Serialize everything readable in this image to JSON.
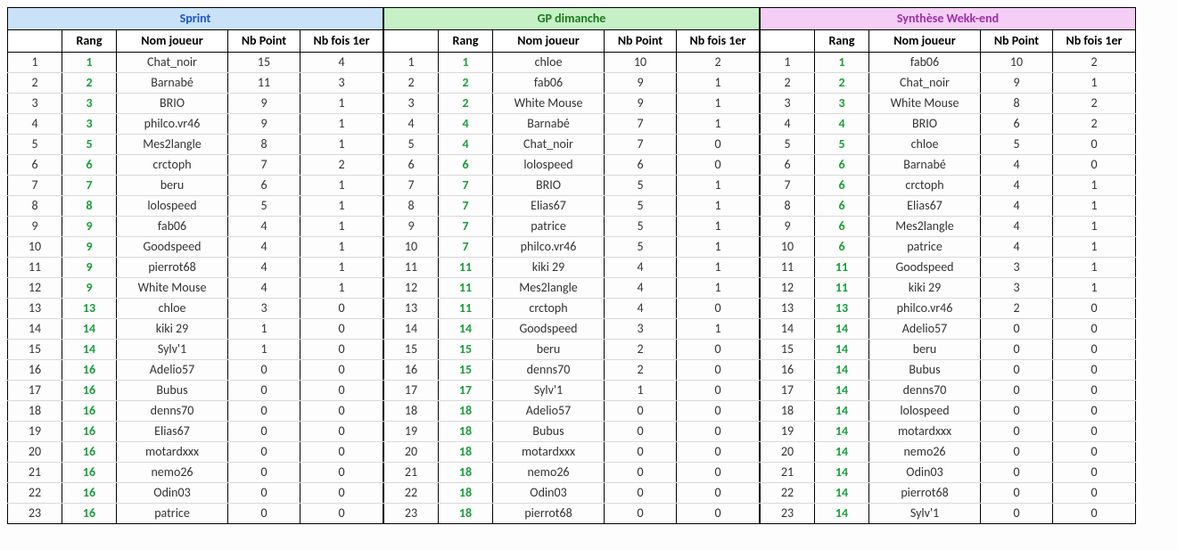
{
  "columns": [
    "",
    "Rang",
    "Nom joueur",
    "Nb Point",
    "Nb fois 1er"
  ],
  "tables": [
    {
      "title": "Sprint",
      "title_class": "bg-sprint",
      "rows": [
        {
          "i": 1,
          "rang": 1,
          "nom": "Chat_noir",
          "pts": 15,
          "f": 4
        },
        {
          "i": 2,
          "rang": 2,
          "nom": "Barnabé",
          "pts": 11,
          "f": 3
        },
        {
          "i": 3,
          "rang": 3,
          "nom": "BRIO",
          "pts": 9,
          "f": 1
        },
        {
          "i": 4,
          "rang": 3,
          "nom": "philco.vr46",
          "pts": 9,
          "f": 1
        },
        {
          "i": 5,
          "rang": 5,
          "nom": "Mes2langle",
          "pts": 8,
          "f": 1
        },
        {
          "i": 6,
          "rang": 6,
          "nom": "crctoph",
          "pts": 7,
          "f": 2
        },
        {
          "i": 7,
          "rang": 7,
          "nom": "beru",
          "pts": 6,
          "f": 1
        },
        {
          "i": 8,
          "rang": 8,
          "nom": "lolospeed",
          "pts": 5,
          "f": 1
        },
        {
          "i": 9,
          "rang": 9,
          "nom": "fab06",
          "pts": 4,
          "f": 1
        },
        {
          "i": 10,
          "rang": 9,
          "nom": "Goodspeed",
          "pts": 4,
          "f": 1
        },
        {
          "i": 11,
          "rang": 9,
          "nom": "pierrot68",
          "pts": 4,
          "f": 1
        },
        {
          "i": 12,
          "rang": 9,
          "nom": "White Mouse",
          "pts": 4,
          "f": 1
        },
        {
          "i": 13,
          "rang": 13,
          "nom": "chloe",
          "pts": 3,
          "f": 0
        },
        {
          "i": 14,
          "rang": 14,
          "nom": "kiki 29",
          "pts": 1,
          "f": 0
        },
        {
          "i": 15,
          "rang": 14,
          "nom": "Sylv'1",
          "pts": 1,
          "f": 0
        },
        {
          "i": 16,
          "rang": 16,
          "nom": "Adelio57",
          "pts": 0,
          "f": 0
        },
        {
          "i": 17,
          "rang": 16,
          "nom": "Bubus",
          "pts": 0,
          "f": 0
        },
        {
          "i": 18,
          "rang": 16,
          "nom": "denns70",
          "pts": 0,
          "f": 0
        },
        {
          "i": 19,
          "rang": 16,
          "nom": "Elias67",
          "pts": 0,
          "f": 0
        },
        {
          "i": 20,
          "rang": 16,
          "nom": "motardxxx",
          "pts": 0,
          "f": 0
        },
        {
          "i": 21,
          "rang": 16,
          "nom": "nemo26",
          "pts": 0,
          "f": 0
        },
        {
          "i": 22,
          "rang": 16,
          "nom": "Odin03",
          "pts": 0,
          "f": 0
        },
        {
          "i": 23,
          "rang": 16,
          "nom": "patrice",
          "pts": 0,
          "f": 0
        }
      ]
    },
    {
      "title": "GP dimanche",
      "title_class": "bg-gp",
      "rows": [
        {
          "i": 1,
          "rang": 1,
          "nom": "chloe",
          "pts": 10,
          "f": 2
        },
        {
          "i": 2,
          "rang": 2,
          "nom": "fab06",
          "pts": 9,
          "f": 1
        },
        {
          "i": 3,
          "rang": 2,
          "nom": "White Mouse",
          "pts": 9,
          "f": 1
        },
        {
          "i": 4,
          "rang": 4,
          "nom": "Barnabé",
          "pts": 7,
          "f": 1
        },
        {
          "i": 5,
          "rang": 4,
          "nom": "Chat_noir",
          "pts": 7,
          "f": 0
        },
        {
          "i": 6,
          "rang": 6,
          "nom": "lolospeed",
          "pts": 6,
          "f": 0
        },
        {
          "i": 7,
          "rang": 7,
          "nom": "BRIO",
          "pts": 5,
          "f": 1
        },
        {
          "i": 8,
          "rang": 7,
          "nom": "Elias67",
          "pts": 5,
          "f": 1
        },
        {
          "i": 9,
          "rang": 7,
          "nom": "patrice",
          "pts": 5,
          "f": 1
        },
        {
          "i": 10,
          "rang": 7,
          "nom": "philco.vr46",
          "pts": 5,
          "f": 1
        },
        {
          "i": 11,
          "rang": 11,
          "nom": "kiki 29",
          "pts": 4,
          "f": 1
        },
        {
          "i": 12,
          "rang": 11,
          "nom": "Mes2langle",
          "pts": 4,
          "f": 1
        },
        {
          "i": 13,
          "rang": 11,
          "nom": "crctoph",
          "pts": 4,
          "f": 0
        },
        {
          "i": 14,
          "rang": 14,
          "nom": "Goodspeed",
          "pts": 3,
          "f": 1
        },
        {
          "i": 15,
          "rang": 15,
          "nom": "beru",
          "pts": 2,
          "f": 0
        },
        {
          "i": 16,
          "rang": 15,
          "nom": "denns70",
          "pts": 2,
          "f": 0
        },
        {
          "i": 17,
          "rang": 17,
          "nom": "Sylv'1",
          "pts": 1,
          "f": 0
        },
        {
          "i": 18,
          "rang": 18,
          "nom": "Adelio57",
          "pts": 0,
          "f": 0
        },
        {
          "i": 19,
          "rang": 18,
          "nom": "Bubus",
          "pts": 0,
          "f": 0
        },
        {
          "i": 20,
          "rang": 18,
          "nom": "motardxxx",
          "pts": 0,
          "f": 0
        },
        {
          "i": 21,
          "rang": 18,
          "nom": "nemo26",
          "pts": 0,
          "f": 0
        },
        {
          "i": 22,
          "rang": 18,
          "nom": "Odin03",
          "pts": 0,
          "f": 0
        },
        {
          "i": 23,
          "rang": 18,
          "nom": "pierrot68",
          "pts": 0,
          "f": 0
        }
      ]
    },
    {
      "title": "Synthèse Wekk-end",
      "title_class": "bg-syn",
      "rows": [
        {
          "i": 1,
          "rang": 1,
          "nom": "fab06",
          "pts": 10,
          "f": 2
        },
        {
          "i": 2,
          "rang": 2,
          "nom": "Chat_noir",
          "pts": 9,
          "f": 1
        },
        {
          "i": 3,
          "rang": 3,
          "nom": "White Mouse",
          "pts": 8,
          "f": 2
        },
        {
          "i": 4,
          "rang": 4,
          "nom": "BRIO",
          "pts": 6,
          "f": 2
        },
        {
          "i": 5,
          "rang": 5,
          "nom": "chloe",
          "pts": 5,
          "f": 0
        },
        {
          "i": 6,
          "rang": 6,
          "nom": "Barnabé",
          "pts": 4,
          "f": 0
        },
        {
          "i": 7,
          "rang": 6,
          "nom": "crctoph",
          "pts": 4,
          "f": 1
        },
        {
          "i": 8,
          "rang": 6,
          "nom": "Elias67",
          "pts": 4,
          "f": 1
        },
        {
          "i": 9,
          "rang": 6,
          "nom": "Mes2langle",
          "pts": 4,
          "f": 1
        },
        {
          "i": 10,
          "rang": 6,
          "nom": "patrice",
          "pts": 4,
          "f": 1
        },
        {
          "i": 11,
          "rang": 11,
          "nom": "Goodspeed",
          "pts": 3,
          "f": 1
        },
        {
          "i": 12,
          "rang": 11,
          "nom": "kiki 29",
          "pts": 3,
          "f": 1
        },
        {
          "i": 13,
          "rang": 13,
          "nom": "philco.vr46",
          "pts": 2,
          "f": 0
        },
        {
          "i": 14,
          "rang": 14,
          "nom": "Adelio57",
          "pts": 0,
          "f": 0
        },
        {
          "i": 15,
          "rang": 14,
          "nom": "beru",
          "pts": 0,
          "f": 0
        },
        {
          "i": 16,
          "rang": 14,
          "nom": "Bubus",
          "pts": 0,
          "f": 0
        },
        {
          "i": 17,
          "rang": 14,
          "nom": "denns70",
          "pts": 0,
          "f": 0
        },
        {
          "i": 18,
          "rang": 14,
          "nom": "lolospeed",
          "pts": 0,
          "f": 0
        },
        {
          "i": 19,
          "rang": 14,
          "nom": "motardxxx",
          "pts": 0,
          "f": 0
        },
        {
          "i": 20,
          "rang": 14,
          "nom": "nemo26",
          "pts": 0,
          "f": 0
        },
        {
          "i": 21,
          "rang": 14,
          "nom": "Odin03",
          "pts": 0,
          "f": 0
        },
        {
          "i": 22,
          "rang": 14,
          "nom": "pierrot68",
          "pts": 0,
          "f": 0
        },
        {
          "i": 23,
          "rang": 14,
          "nom": "Sylv'1",
          "pts": 0,
          "f": 0
        }
      ]
    }
  ]
}
